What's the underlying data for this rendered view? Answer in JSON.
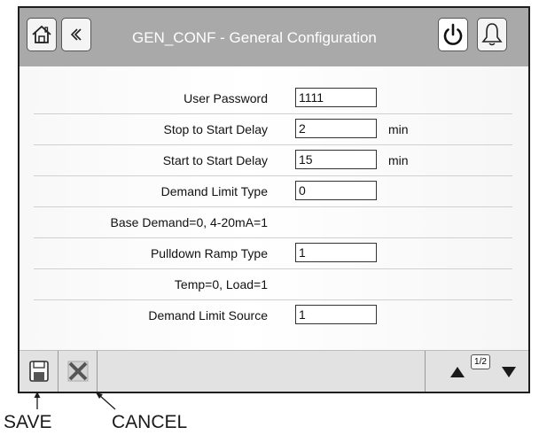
{
  "header": {
    "title": "GEN_CONF - General Configuration",
    "icons": [
      "home-icon",
      "back-icon",
      "power-icon",
      "bell-icon"
    ]
  },
  "parameters": [
    {
      "label": "User Password",
      "value": "1111",
      "unit": ""
    },
    {
      "label": "Stop to Start Delay",
      "value": "2",
      "unit": "min"
    },
    {
      "label": "Start to Start Delay",
      "value": "15",
      "unit": "min"
    },
    {
      "label": "Demand Limit Type",
      "value": "0",
      "unit": ""
    },
    {
      "label": "Base Demand=0, 4-20mA=1",
      "value": null,
      "unit": ""
    },
    {
      "label": "Pulldown Ramp Type",
      "value": "1",
      "unit": ""
    },
    {
      "label": "Temp=0, Load=1",
      "value": null,
      "unit": ""
    },
    {
      "label": "Demand Limit Source",
      "value": "1",
      "unit": ""
    }
  ],
  "footer": {
    "page_indicator": "1/2",
    "icons": [
      "save-icon",
      "cancel-icon",
      "up-arrow-icon",
      "down-arrow-icon"
    ]
  },
  "annotations": {
    "save": "SAVE",
    "cancel": "CANCEL"
  },
  "colors": {
    "header_bg": "#a9a9a9",
    "footer_bg": "#e2e2e2",
    "frame_border": "#1e1e1e"
  }
}
